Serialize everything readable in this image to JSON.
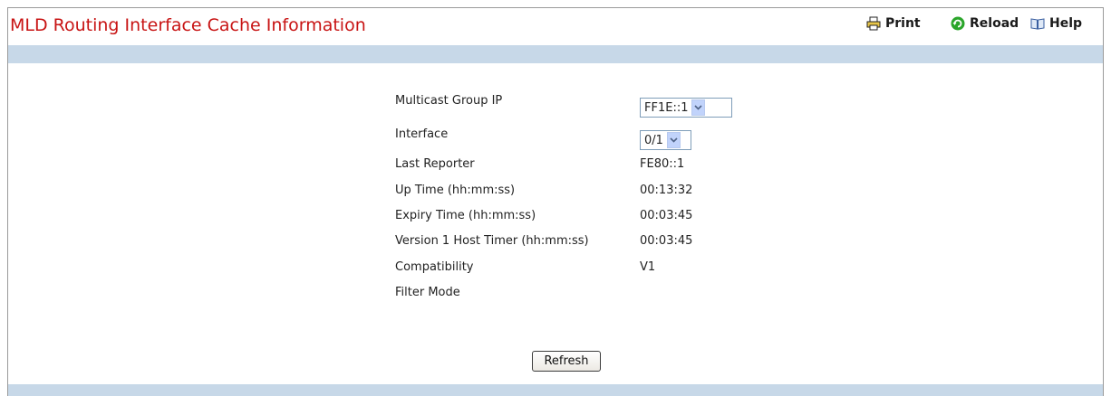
{
  "page": {
    "title": "MLD Routing Interface Cache Information"
  },
  "toolbar": {
    "print_label": "Print",
    "print_icon": "printer-icon",
    "reload_label": "Reload",
    "reload_icon": "reload-icon",
    "help_label": "Help",
    "help_icon": "book-help-icon"
  },
  "form": {
    "multicast_group_ip": {
      "label": "Multicast Group IP",
      "selected": "FF1E::1"
    },
    "interface": {
      "label": "Interface",
      "selected": "0/1"
    },
    "fields": [
      {
        "label": "Last Reporter",
        "value": "FE80::1"
      },
      {
        "label": "Up Time (hh:mm:ss)",
        "value": "00:13:32"
      },
      {
        "label": "Expiry Time (hh:mm:ss)",
        "value": "00:03:45"
      },
      {
        "label": "Version 1 Host Timer (hh:mm:ss)",
        "value": "00:03:45"
      },
      {
        "label": "Compatibility",
        "value": "V1"
      },
      {
        "label": "Filter Mode",
        "value": ""
      }
    ],
    "refresh_label": "Refresh"
  },
  "colors": {
    "title": "#c81414",
    "band": "#c7d8e8",
    "reload_icon": "#2aa52a"
  }
}
